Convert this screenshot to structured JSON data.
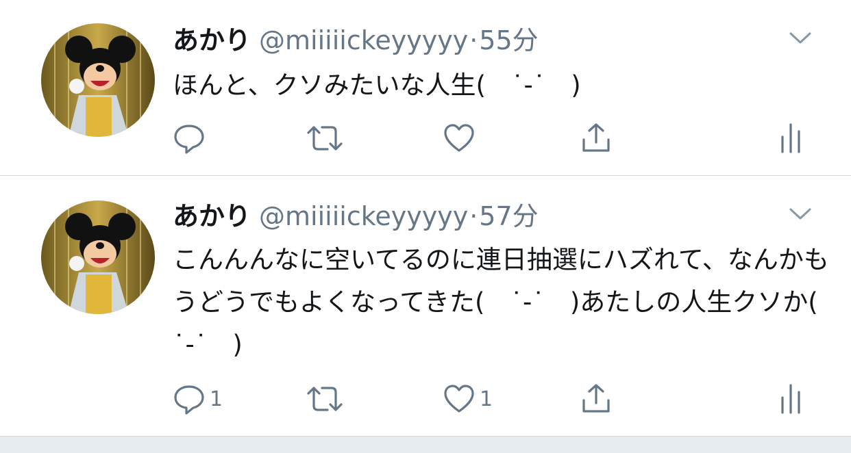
{
  "tweets": [
    {
      "name": "あかり",
      "handle": "@miiiiickeyyyyy",
      "separator": "·",
      "time": "55分",
      "text": "ほんと、クソみたいな人生(　˙-˙　)",
      "reply_count": "",
      "like_count": ""
    },
    {
      "name": "あかり",
      "handle": "@miiiiickeyyyyy",
      "separator": "·",
      "time": "57分",
      "text": "こんんんなに空いてるのに連日抽選にハズれて、なんかもうどうでもよくなってきた(　˙-˙　)あたしの人生クソか(　˙-˙　)",
      "reply_count": "1",
      "like_count": "1"
    }
  ],
  "icons": {
    "reply": "reply-icon",
    "retweet": "retweet-icon",
    "like": "heart-icon",
    "share": "share-icon",
    "stats": "analytics-icon",
    "menu": "chevron-down-icon"
  },
  "colors": {
    "text": "#14171a",
    "secondary": "#657786",
    "divider": "#d6d9dc",
    "background": "#ffffff"
  }
}
